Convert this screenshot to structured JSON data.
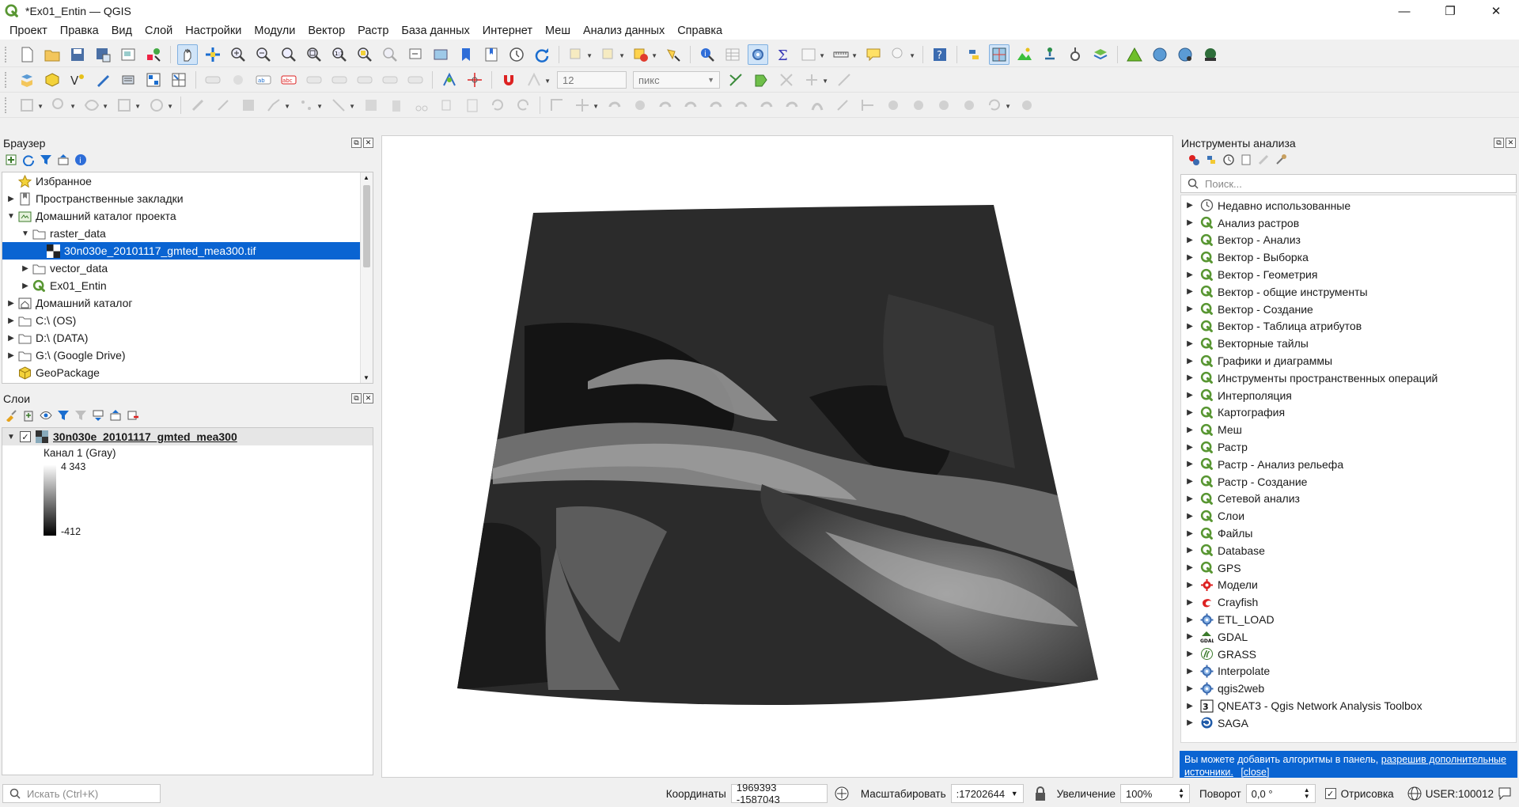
{
  "window": {
    "title": "*Ex01_Entin — QGIS",
    "min": "—",
    "max": "❐",
    "close": "✕"
  },
  "menu": [
    "Проект",
    "Правка",
    "Вид",
    "Слой",
    "Настройки",
    "Модули",
    "Вектор",
    "Растр",
    "База данных",
    "Интернет",
    "Меш",
    "Анализ данных",
    "Справка"
  ],
  "toolbar2": {
    "size_value": "12",
    "unit": "пикс"
  },
  "browser": {
    "title": "Браузер",
    "items": [
      {
        "label": "Избранное",
        "icon": "star-icon",
        "arrow": "",
        "indent": 0
      },
      {
        "label": "Пространственные закладки",
        "icon": "bookmark-icon",
        "arrow": "▶",
        "indent": 0
      },
      {
        "label": "Домашний каталог проекта",
        "icon": "project-home-icon",
        "arrow": "▼",
        "indent": 0
      },
      {
        "label": "raster_data",
        "icon": "folder-icon",
        "arrow": "▼",
        "indent": 1
      },
      {
        "label": "30n030e_20101117_gmted_mea300.tif",
        "icon": "raster-icon",
        "arrow": "",
        "indent": 2,
        "selected": true
      },
      {
        "label": "vector_data",
        "icon": "folder-icon",
        "arrow": "▶",
        "indent": 1
      },
      {
        "label": "Ex01_Entin",
        "icon": "qgis-project-icon",
        "arrow": "▶",
        "indent": 1
      },
      {
        "label": "Домашний каталог",
        "icon": "home-icon",
        "arrow": "▶",
        "indent": 0
      },
      {
        "label": "C:\\ (OS)",
        "icon": "folder-icon",
        "arrow": "▶",
        "indent": 0
      },
      {
        "label": "D:\\ (DATA)",
        "icon": "folder-icon",
        "arrow": "▶",
        "indent": 0
      },
      {
        "label": "G:\\ (Google Drive)",
        "icon": "folder-icon",
        "arrow": "▶",
        "indent": 0
      },
      {
        "label": "GeoPackage",
        "icon": "geopackage-icon",
        "arrow": "",
        "indent": 0
      }
    ]
  },
  "layers": {
    "title": "Слои",
    "layer_name": "30n030e_20101117_gmted_mea300",
    "band": "Канал 1 (Gray)",
    "max": "4 343",
    "min": "-412"
  },
  "toolbox": {
    "title": "Инструменты анализа",
    "search_placeholder": "Поиск...",
    "items": [
      {
        "label": "Недавно использованные",
        "icon": "clock-icon"
      },
      {
        "label": "Анализ растров",
        "icon": "qgis-icon"
      },
      {
        "label": "Вектор - Анализ",
        "icon": "qgis-icon"
      },
      {
        "label": "Вектор - Выборка",
        "icon": "qgis-icon"
      },
      {
        "label": "Вектор - Геометрия",
        "icon": "qgis-icon"
      },
      {
        "label": "Вектор - общие инструменты",
        "icon": "qgis-icon"
      },
      {
        "label": "Вектор - Создание",
        "icon": "qgis-icon"
      },
      {
        "label": "Вектор - Таблица атрибутов",
        "icon": "qgis-icon"
      },
      {
        "label": "Векторные тайлы",
        "icon": "qgis-icon"
      },
      {
        "label": "Графики и диаграммы",
        "icon": "qgis-icon"
      },
      {
        "label": "Инструменты пространственных операций",
        "icon": "qgis-icon"
      },
      {
        "label": "Интерполяция",
        "icon": "qgis-icon"
      },
      {
        "label": "Картография",
        "icon": "qgis-icon"
      },
      {
        "label": "Меш",
        "icon": "qgis-icon"
      },
      {
        "label": "Растр",
        "icon": "qgis-icon"
      },
      {
        "label": "Растр - Анализ рельефа",
        "icon": "qgis-icon"
      },
      {
        "label": "Растр - Создание",
        "icon": "qgis-icon"
      },
      {
        "label": "Сетевой анализ",
        "icon": "qgis-icon"
      },
      {
        "label": "Слои",
        "icon": "qgis-icon"
      },
      {
        "label": "Файлы",
        "icon": "qgis-icon"
      },
      {
        "label": "Database",
        "icon": "qgis-icon"
      },
      {
        "label": "GPS",
        "icon": "qgis-icon"
      },
      {
        "label": "Модели",
        "icon": "models-icon"
      },
      {
        "label": "Crayfish",
        "icon": "crayfish-icon"
      },
      {
        "label": "ETL_LOAD",
        "icon": "gear-icon"
      },
      {
        "label": "GDAL",
        "icon": "gdal-icon"
      },
      {
        "label": "GRASS",
        "icon": "grass-icon"
      },
      {
        "label": "Interpolate",
        "icon": "gear-icon"
      },
      {
        "label": "qgis2web",
        "icon": "gear-icon"
      },
      {
        "label": "QNEAT3 - Qgis Network Analysis Toolbox",
        "icon": "qneat-icon"
      },
      {
        "label": "SAGA",
        "icon": "saga-icon"
      }
    ],
    "note_text": "Вы можете добавить алгоритмы в панель,",
    "note_link": "разрешив дополнительные источники.",
    "note_close": "[close]"
  },
  "status": {
    "search_placeholder": "Искать (Ctrl+K)",
    "coords_label": "Координаты",
    "coords_value": "1969393 -1587043",
    "scale_label": "Масштабировать",
    "scale_value": ":17202644",
    "magnifier_label": "Увеличение",
    "magnifier_value": "100%",
    "rotation_label": "Поворот",
    "rotation_value": "0,0 °",
    "render_label": "Отрисовка",
    "crs": "USER:100012"
  }
}
